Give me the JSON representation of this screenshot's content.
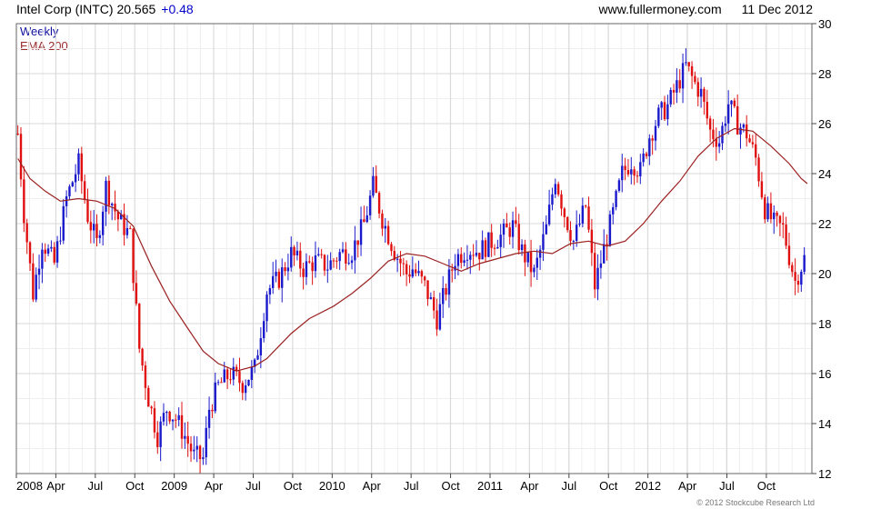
{
  "header": {
    "ticker": "Intel Corp (INTC) 20.565",
    "change": "+0.48",
    "site": "www.fullermoney.com",
    "date": "11 Dec 2012"
  },
  "legend": {
    "weekly": "Weekly",
    "ema": "EMA 200"
  },
  "copyright": "© 2012 Stockcube Research Ltd",
  "colors": {
    "up": "#1a1acc",
    "down": "#e01010",
    "ema": "#9b2020",
    "grid": "#d8d8d8"
  },
  "chart_data": {
    "type": "candlestick",
    "title": "Intel Corp (INTC) 20.565 +0.48",
    "ylim": [
      12,
      30
    ],
    "yticks": [
      12,
      14,
      16,
      18,
      20,
      22,
      24,
      26,
      28,
      30
    ],
    "xticks": [
      "2008",
      "Apr",
      "Jul",
      "Oct",
      "2009",
      "Apr",
      "Jul",
      "Oct",
      "2010",
      "Apr",
      "Jul",
      "Oct",
      "2011",
      "Apr",
      "Jul",
      "Oct",
      "2012",
      "Apr",
      "Jul",
      "Oct"
    ],
    "x_tick_weeks": [
      0,
      13,
      26,
      39,
      52,
      65,
      78,
      91,
      104,
      117,
      130,
      143,
      156,
      169,
      182,
      195,
      208,
      221,
      234,
      247
    ],
    "grid": true,
    "series": [
      {
        "name": "Weekly",
        "type": "candlestick",
        "close_points": [
          [
            0,
            25.6
          ],
          [
            2,
            22.4
          ],
          [
            5,
            19.2
          ],
          [
            8,
            21.3
          ],
          [
            12,
            20.4
          ],
          [
            16,
            23.0
          ],
          [
            20,
            24.4
          ],
          [
            23,
            22.3
          ],
          [
            26,
            21.2
          ],
          [
            29,
            23.5
          ],
          [
            33,
            22.2
          ],
          [
            37,
            21.5
          ],
          [
            40,
            17.0
          ],
          [
            43,
            15.0
          ],
          [
            46,
            13.5
          ],
          [
            49,
            14.6
          ],
          [
            52,
            14.2
          ],
          [
            55,
            13.5
          ],
          [
            58,
            12.7
          ],
          [
            61,
            12.6
          ],
          [
            63,
            14.6
          ],
          [
            66,
            15.5
          ],
          [
            70,
            16.0
          ],
          [
            74,
            15.6
          ],
          [
            78,
            16.2
          ],
          [
            82,
            19.3
          ],
          [
            86,
            19.8
          ],
          [
            90,
            20.8
          ],
          [
            94,
            20.2
          ],
          [
            98,
            20.5
          ],
          [
            102,
            20.3
          ],
          [
            106,
            20.8
          ],
          [
            110,
            20.9
          ],
          [
            114,
            22.0
          ],
          [
            117,
            23.5
          ],
          [
            120,
            22.2
          ],
          [
            124,
            20.9
          ],
          [
            128,
            20.0
          ],
          [
            130,
            20.2
          ],
          [
            134,
            19.5
          ],
          [
            138,
            18.2
          ],
          [
            141,
            19.4
          ],
          [
            144,
            20.6
          ],
          [
            148,
            21.0
          ],
          [
            152,
            20.9
          ],
          [
            155,
            21.2
          ],
          [
            159,
            21.5
          ],
          [
            163,
            21.9
          ],
          [
            166,
            20.9
          ],
          [
            170,
            20.0
          ],
          [
            174,
            21.8
          ],
          [
            177,
            23.9
          ],
          [
            180,
            22.4
          ],
          [
            183,
            21.3
          ],
          [
            187,
            22.7
          ],
          [
            190,
            19.5
          ],
          [
            193,
            21.0
          ],
          [
            196,
            22.4
          ],
          [
            199,
            24.0
          ],
          [
            202,
            24.5
          ],
          [
            205,
            24.1
          ],
          [
            208,
            25.5
          ],
          [
            211,
            26.3
          ],
          [
            214,
            26.7
          ],
          [
            217,
            27.5
          ],
          [
            220,
            28.3
          ],
          [
            223,
            27.6
          ],
          [
            225,
            27.2
          ],
          [
            228,
            25.7
          ],
          [
            231,
            25.3
          ],
          [
            234,
            26.8
          ],
          [
            237,
            26.0
          ],
          [
            240,
            25.6
          ],
          [
            243,
            24.6
          ],
          [
            246,
            22.6
          ],
          [
            249,
            22.0
          ],
          [
            252,
            21.8
          ],
          [
            254,
            20.7
          ],
          [
            256,
            19.7
          ],
          [
            259,
            20.6
          ]
        ],
        "ema_points": [
          [
            0,
            24.6
          ],
          [
            4,
            23.8
          ],
          [
            9,
            23.3
          ],
          [
            14,
            22.9
          ],
          [
            20,
            23.0
          ],
          [
            26,
            22.9
          ],
          [
            32,
            22.6
          ],
          [
            38,
            21.9
          ],
          [
            44,
            20.3
          ],
          [
            50,
            18.9
          ],
          [
            56,
            17.8
          ],
          [
            61,
            16.9
          ],
          [
            66,
            16.4
          ],
          [
            72,
            16.1
          ],
          [
            78,
            16.3
          ],
          [
            82,
            16.6
          ],
          [
            86,
            17.1
          ],
          [
            90,
            17.6
          ],
          [
            96,
            18.2
          ],
          [
            104,
            18.7
          ],
          [
            110,
            19.2
          ],
          [
            116,
            19.8
          ],
          [
            122,
            20.5
          ],
          [
            128,
            20.8
          ],
          [
            134,
            20.7
          ],
          [
            140,
            20.4
          ],
          [
            146,
            20.1
          ],
          [
            152,
            20.4
          ],
          [
            158,
            20.6
          ],
          [
            164,
            20.8
          ],
          [
            170,
            20.9
          ],
          [
            176,
            20.8
          ],
          [
            182,
            21.2
          ],
          [
            188,
            21.3
          ],
          [
            194,
            21.1
          ],
          [
            200,
            21.3
          ],
          [
            206,
            22.0
          ],
          [
            212,
            22.9
          ],
          [
            218,
            23.7
          ],
          [
            224,
            24.7
          ],
          [
            230,
            25.4
          ],
          [
            236,
            25.8
          ],
          [
            242,
            25.7
          ],
          [
            248,
            25.1
          ],
          [
            254,
            24.4
          ],
          [
            258,
            23.8
          ],
          [
            260,
            23.6
          ]
        ]
      }
    ],
    "ema_label": "EMA 200"
  }
}
